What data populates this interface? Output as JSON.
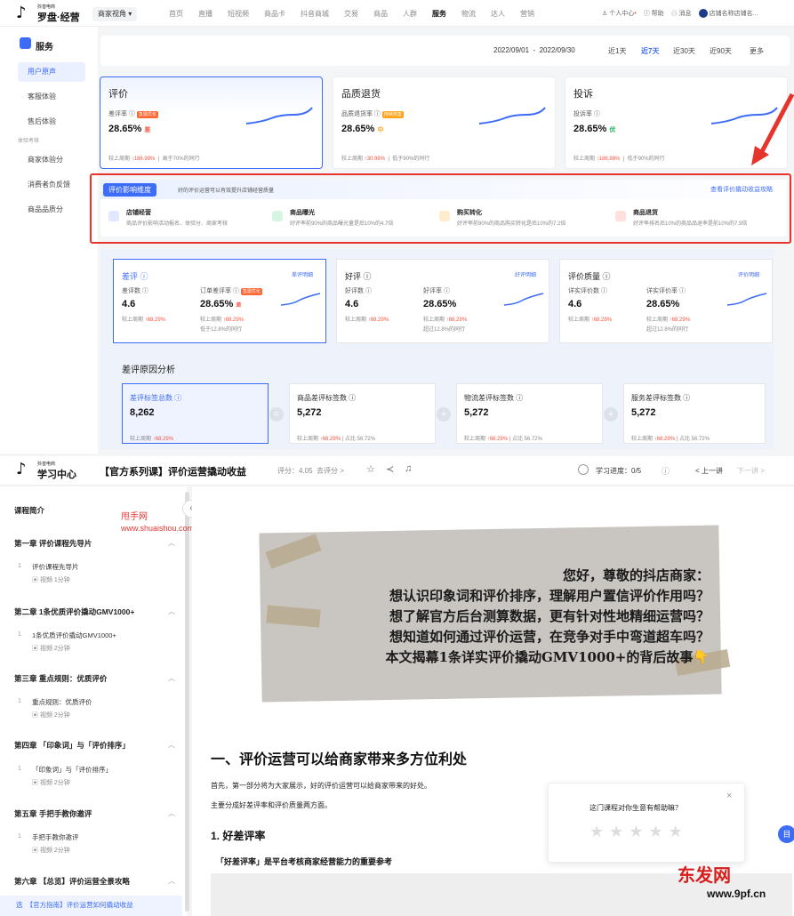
{
  "header": {
    "logo_sub": "抖音电商",
    "logo_main": "罗盘·经营",
    "perspective": "商家视角",
    "nav": [
      "首页",
      "直播",
      "短视频",
      "商品卡",
      "抖音商城",
      "交易",
      "商品",
      "人群",
      "服务",
      "物流",
      "达人",
      "营销"
    ],
    "nav_active": "服务",
    "personal": "个人中心",
    "help": "帮助",
    "message": "消息",
    "store": "店铺名称店铺名..."
  },
  "sidebar": {
    "title": "服务",
    "items": [
      "用户原声",
      "客服体验",
      "售后体验"
    ],
    "group": "体验考核",
    "items2": [
      "商家体验分",
      "消费者负反馈",
      "商品品质分"
    ]
  },
  "datebar": {
    "start": "2022/09/01",
    "end": "2022/09/30",
    "buttons": [
      "近1天",
      "近7天",
      "近30天",
      "近90天",
      "更多"
    ]
  },
  "metric_cards": [
    {
      "title": "评价",
      "label": "差评率",
      "tag": "急需优化",
      "value": "28.65%",
      "badge": "差",
      "compare": "较上周期",
      "delta": "186.98%",
      "peer": "高于70%的同行"
    },
    {
      "title": "品质退货",
      "label": "品质退货率",
      "tag": "持续改善",
      "value": "28.65%",
      "badge": "中",
      "compare": "较上周期",
      "delta": "30.98%",
      "peer": "低于90%的同行"
    },
    {
      "title": "投诉",
      "label": "投诉率",
      "tag": "",
      "value": "28.65%",
      "badge": "优",
      "compare": "较上周期",
      "delta": "186.98%",
      "peer": "低于90%的同行"
    }
  ],
  "dimension": {
    "tag": "评价影响维度",
    "subtitle": "好的评价运营可以有效提升店铺经营质量",
    "link": "查看评价撬动收益攻略",
    "items": [
      {
        "title": "店铺经营",
        "desc": "商品评价影响活动报名、体验分、商家考核"
      },
      {
        "title": "商品曝光",
        "desc": "好评率前90%的商品曝光量是后10%的4.7倍"
      },
      {
        "title": "购买转化",
        "desc": "好评率前90%的商品购买转化是后10%的7.2倍"
      },
      {
        "title": "商品退货",
        "desc": "好评率排名后10%的商品品退率是前10%的7.9倍"
      }
    ]
  },
  "sub_cards": [
    {
      "title": "差评",
      "link": "差评明细",
      "l1": "差评数",
      "v1": "4.6",
      "l2": "订单差评率",
      "tag": "急需优化",
      "v2": "28.65%",
      "badge": "差",
      "cmp1": "较上周期",
      "d1": "68.29%",
      "cmp2": "较上周期",
      "d2": "68.29%",
      "peer": "低于12.8%的同行"
    },
    {
      "title": "好评",
      "link": "好评明细",
      "l1": "好评数",
      "v1": "4.6",
      "l2": "好评率",
      "tag": "",
      "v2": "28.65%",
      "badge": "",
      "cmp1": "较上周期",
      "d1": "68.29%",
      "cmp2": "较上周期",
      "d2": "68.29%",
      "peer": "超过12.8%的同行"
    },
    {
      "title": "评价质量",
      "link": "评价明细",
      "l1": "详实评价数",
      "v1": "4.6",
      "l2": "详实评价率",
      "tag": "",
      "v2": "28.65%",
      "badge": "",
      "cmp1": "较上周期",
      "d1": "68.29%",
      "cmp2": "较上周期",
      "d2": "68.29%",
      "peer": "超过12.8%的同行"
    }
  ],
  "reason": {
    "title": "差评原因分析",
    "cards": [
      {
        "label": "差评标签总数",
        "value": "8,262",
        "cmp": "较上周期",
        "delta": "68.29%",
        "share": ""
      },
      {
        "label": "商品差评标签数",
        "value": "5,272",
        "cmp": "较上周期",
        "delta": "68.29%",
        "share": "占比 56.72%"
      },
      {
        "label": "物流差评标签数",
        "value": "5,272",
        "cmp": "较上周期",
        "delta": "68.29%",
        "share": "占比 56.72%"
      },
      {
        "label": "服务差评标签数",
        "value": "5,272",
        "cmp": "较上周期",
        "delta": "68.29%",
        "share": "占比 56.72%"
      }
    ],
    "ops": [
      "=",
      "+",
      "+"
    ]
  },
  "learn": {
    "logo_sub": "抖音电商",
    "logo_main": "学习中心",
    "course_title": "【官方系列课】评价运营撬动收益",
    "score": "评分：4.05",
    "rate": "去评分 >",
    "progress": "学习进度：0/5",
    "prev": "< 上一讲",
    "next": "下一讲 >",
    "intro": "课程简介",
    "watermark1": "甩手网",
    "watermark2": "www.shuaishou.com",
    "collapse": "«",
    "chapters": [
      {
        "title": "第一章 评价课程先导片",
        "lesson": "评价课程先导片",
        "video": "视频 1分钟"
      },
      {
        "title": "第二章 1条优质评价撬动GMV1000+",
        "lesson": "1条优质评价撬动GMV1000+",
        "video": "视频 2分钟"
      },
      {
        "title": "第三章 重点规则：优质评价",
        "lesson": "重点规则：优质评价",
        "video": "视频 2分钟"
      },
      {
        "title": "第四章 「印象词」与「评价排序」",
        "lesson": "「印象词」与「评价排序」",
        "video": "视频 2分钟"
      },
      {
        "title": "第五章 手把手教你邀评",
        "lesson": "手把手教你邀评",
        "video": "视频 2分钟"
      },
      {
        "title": "第六章 【总览】评价运营全景攻略",
        "lesson": "【官方指南】评价运营如何撬动收益",
        "video": ""
      }
    ],
    "banner_lines": [
      "您好，尊敬的抖店商家：",
      "想认识印象词和评价排序，理解用户置信评价作用吗？",
      "想了解官方后台测算数据，更有针对性地精细运营吗？",
      "想知道如何通过评价运营，在竞争对手中弯道超车吗？",
      "本文揭幕1条详实评价撬动GMV1000+的背后故事👇"
    ],
    "h1": "一、评价运营可以给商家带来多方位利处",
    "p1": "首先，第一部分将为大家展示，好的评价运营可以给商家带来的好处。",
    "p2": "主要分成好差评率和评价质量两方面。",
    "h2": "1. 好差评率",
    "h3": "「好差评率」是平台考核商家经营能力的重要参考",
    "popup": "这门课程对你生意有帮助嘛？",
    "popup_close": "×",
    "float_btn": "目",
    "wm_brand": "东发网",
    "wm_url": "www.9pf.cn"
  }
}
